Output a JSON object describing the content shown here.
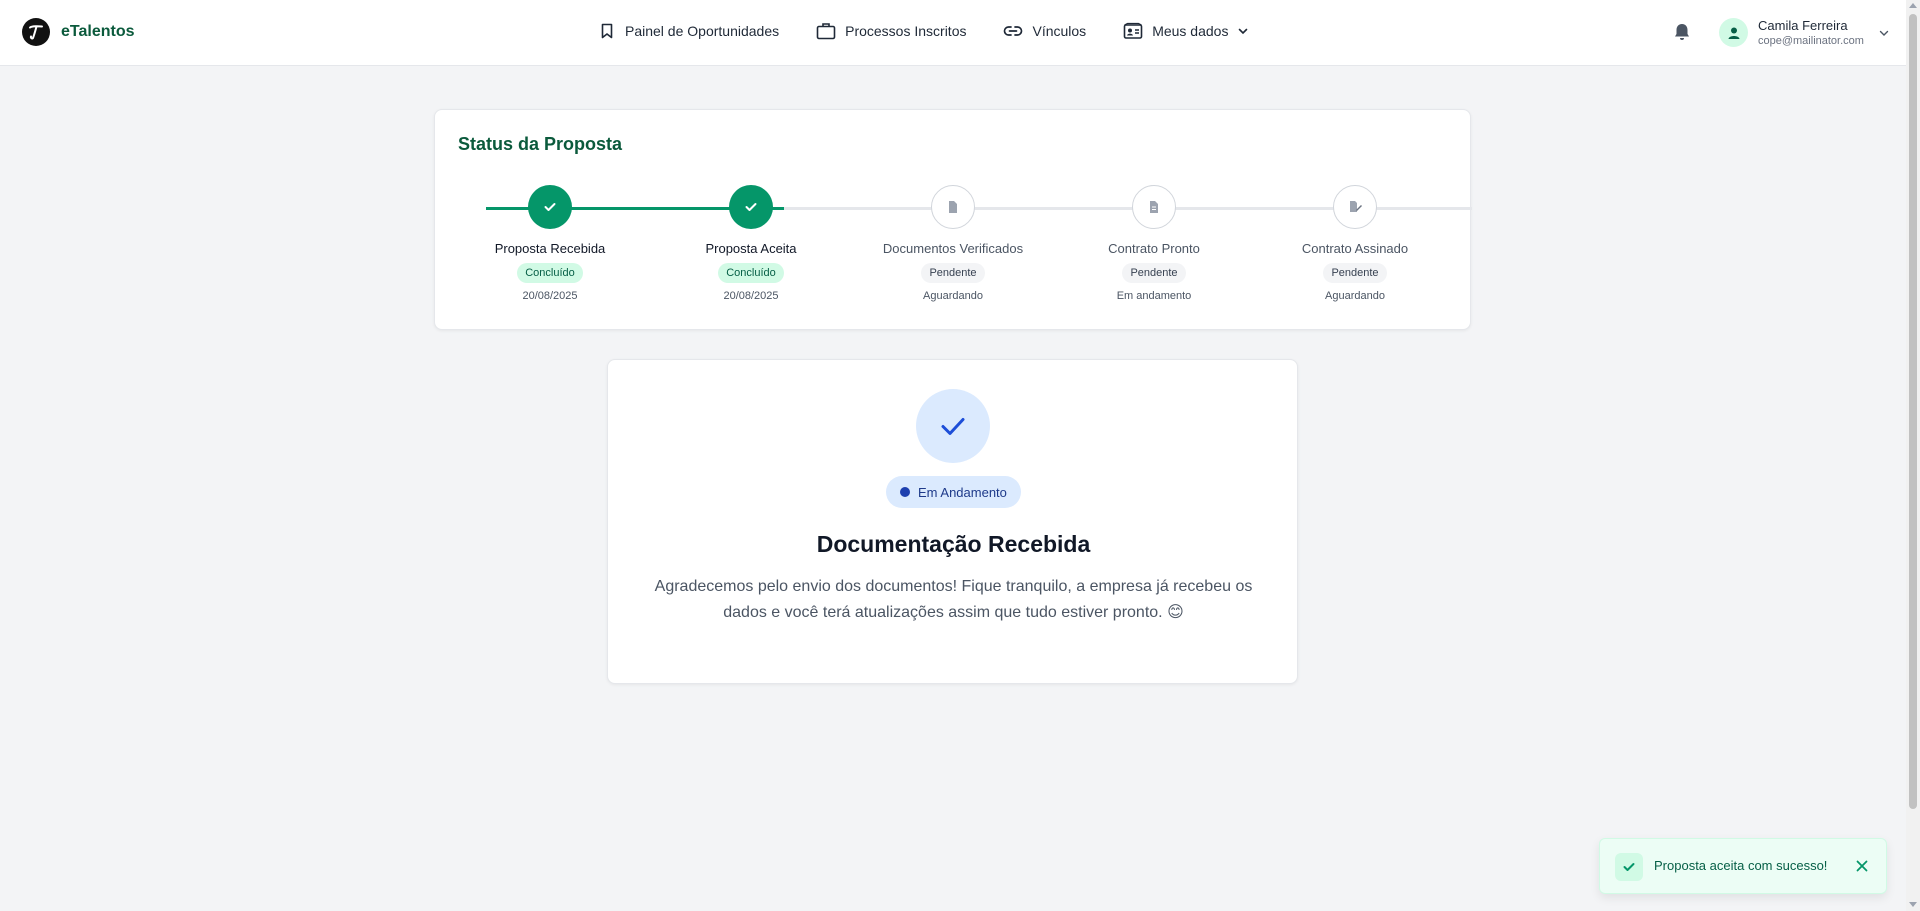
{
  "header": {
    "brand": "eTalentos",
    "nav": [
      {
        "label": "Painel de Oportunidades",
        "icon": "bookmark-icon"
      },
      {
        "label": "Processos Inscritos",
        "icon": "briefcase-icon"
      },
      {
        "label": "Vínculos",
        "icon": "link-icon"
      },
      {
        "label": "Meus dados",
        "icon": "id-card-icon"
      }
    ],
    "user": {
      "name": "Camila Ferreira",
      "email": "cope@mailinator.com"
    }
  },
  "status": {
    "title": "Status da Proposta",
    "steps": [
      {
        "label": "Proposta Recebida",
        "badge": "Concluído",
        "detail": "20/08/2025",
        "state": "done",
        "icon": "check-icon"
      },
      {
        "label": "Proposta Aceita",
        "badge": "Concluído",
        "detail": "20/08/2025",
        "state": "done",
        "icon": "check-icon"
      },
      {
        "label": "Documentos Verificados",
        "badge": "Pendente",
        "detail": "Aguardando",
        "state": "pending",
        "icon": "document-icon"
      },
      {
        "label": "Contrato Pronto",
        "badge": "Pendente",
        "detail": "Em andamento",
        "state": "pending",
        "icon": "file-text-icon"
      },
      {
        "label": "Contrato Assinado",
        "badge": "Pendente",
        "detail": "Aguardando",
        "state": "pending",
        "icon": "signature-icon"
      }
    ]
  },
  "main": {
    "badge": "Em Andamento",
    "title": "Documentação Recebida",
    "message": "Agradecemos pelo envio dos documentos! Fique tranquilo, a empresa já recebeu os dados e você terá atualizações assim que tudo estiver pronto. 😊"
  },
  "toast": {
    "message": "Proposta aceita com sucesso!"
  },
  "colors": {
    "brand": "#0b5a3c",
    "success": "#059669",
    "success_bg": "#d1fae5",
    "info_bg": "#dbeafe",
    "info": "#1e40af",
    "page_bg": "#f3f4f6"
  }
}
